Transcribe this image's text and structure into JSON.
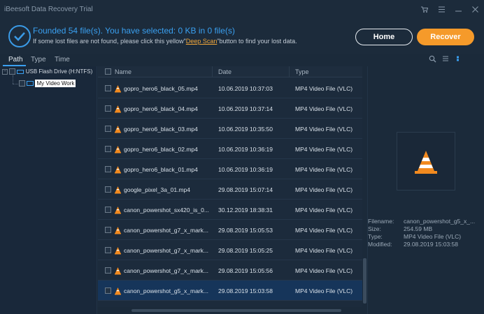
{
  "window": {
    "title": "iBeesoft Data Recovery Trial"
  },
  "header": {
    "found_text": "Founded 54 file(s).  You have selected: 0 KB in 0 file(s)",
    "hint_prefix": "If some lost files are not found, please click this yellow\"",
    "hint_link": "Deep Scan",
    "hint_suffix": "\"button to find your lost data.",
    "home_label": "Home",
    "recover_label": "Recover"
  },
  "tabs": [
    {
      "label": "Path"
    },
    {
      "label": "Type"
    },
    {
      "label": "Time"
    }
  ],
  "tree": {
    "drive": "USB Flash Drive (H:NTFS)",
    "folder": "My Video Work"
  },
  "columns": {
    "name": "Name",
    "date": "Date",
    "type": "Type"
  },
  "files": [
    {
      "name": "gopro_hero6_black_05.mp4",
      "date": "10.06.2019 10:37:03",
      "type": "MP4 Video File (VLC)"
    },
    {
      "name": "gopro_hero6_black_04.mp4",
      "date": "10.06.2019 10:37:14",
      "type": "MP4 Video File (VLC)"
    },
    {
      "name": "gopro_hero6_black_03.mp4",
      "date": "10.06.2019 10:35:50",
      "type": "MP4 Video File (VLC)"
    },
    {
      "name": "gopro_hero6_black_02.mp4",
      "date": "10.06.2019 10:36:19",
      "type": "MP4 Video File (VLC)"
    },
    {
      "name": "gopro_hero6_black_01.mp4",
      "date": "10.06.2019 10:36:19",
      "type": "MP4 Video File (VLC)"
    },
    {
      "name": "google_pixel_3a_01.mp4",
      "date": "29.08.2019 15:07:14",
      "type": "MP4 Video File (VLC)"
    },
    {
      "name": "canon_powershot_sx420_is_0...",
      "date": "30.12.2019 18:38:31",
      "type": "MP4 Video File (VLC)"
    },
    {
      "name": "canon_powershot_g7_x_mark...",
      "date": "29.08.2019 15:05:53",
      "type": "MP4 Video File (VLC)"
    },
    {
      "name": "canon_powershot_g7_x_mark...",
      "date": "29.08.2019 15:05:25",
      "type": "MP4 Video File (VLC)"
    },
    {
      "name": "canon_powershot_g7_x_mark...",
      "date": "29.08.2019 15:05:56",
      "type": "MP4 Video File (VLC)"
    },
    {
      "name": "canon_powershot_g5_x_mark...",
      "date": "29.08.2019 15:03:58",
      "type": "MP4 Video File (VLC)"
    }
  ],
  "details": {
    "filename_label": "Filename:",
    "filename": "canon_powershot_g5_x_...",
    "size_label": "Size:",
    "size": "254.59 MB",
    "type_label": "Type:",
    "type": "MP4 Video File (VLC)",
    "modified_label": "Modified:",
    "modified": "29.08.2019 15:03:58"
  },
  "icons": {
    "app": "cart-icon",
    "menu": "menu-icon",
    "minimize": "minimize-icon",
    "close": "close-icon",
    "search": "search-icon",
    "list_view": "list-view-icon",
    "detail_view": "detail-view-icon",
    "file": "vlc-cone-icon"
  },
  "colors": {
    "accent": "#3aa0f0",
    "recover": "#f59a2a",
    "deep_scan": "#f0a63a",
    "selected_row": "#16355a"
  }
}
